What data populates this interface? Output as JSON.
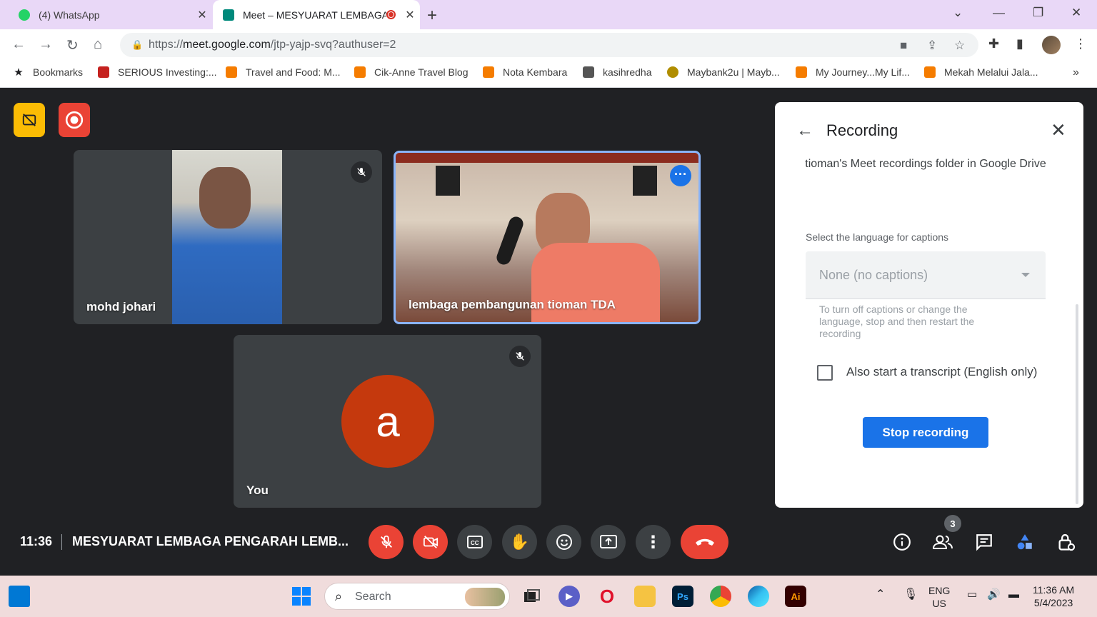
{
  "browser": {
    "tabs": [
      {
        "title": "(4) WhatsApp",
        "favicon_color": "#25d366"
      },
      {
        "title": "Meet – MESYUARAT LEMBAGA",
        "favicon_color": "#00897b"
      }
    ],
    "url_prefix": "https://",
    "url_host": "meet.google.com",
    "url_path": "/jtp-yajp-svq?authuser=2",
    "bookmarks": [
      {
        "label": "Bookmarks",
        "color": "#202124"
      },
      {
        "label": "SERIOUS Investing:...",
        "color": "#c5221f"
      },
      {
        "label": "Travel and Food: M...",
        "color": "#f57c00"
      },
      {
        "label": "Cik-Anne Travel Blog",
        "color": "#f57c00"
      },
      {
        "label": "Nota Kembara",
        "color": "#f57c00"
      },
      {
        "label": "kasihredha",
        "color": "#555555"
      },
      {
        "label": "Maybank2u | Mayb...",
        "color": "#b08d00"
      },
      {
        "label": "My Journey...My Lif...",
        "color": "#f57c00"
      },
      {
        "label": "Mekah Melalui Jala...",
        "color": "#f57c00"
      }
    ],
    "more_bookmarks": "»"
  },
  "meet": {
    "participants": [
      {
        "name": "mohd johari"
      },
      {
        "name": "lembaga pembangunan tioman TDA"
      },
      {
        "name": "You",
        "avatar_letter": "a",
        "avatar_color": "#c5390d"
      }
    ],
    "panel": {
      "title": "Recording",
      "description": "tioman's Meet recordings folder in Google Drive",
      "caption_label": "Select the language for captions",
      "caption_value": "None (no captions)",
      "hint": "To turn off captions or change the language, stop and then restart the recording",
      "transcript_label": "Also start a transcript (English only)",
      "stop_button": "Stop recording"
    },
    "clock": "11:36",
    "meeting_title": "MESYUARAT LEMBAGA PENGARAH LEMB...",
    "people_count": "3"
  },
  "taskbar": {
    "search_placeholder": "Search",
    "lang_line1": "ENG",
    "lang_line2": "US",
    "time": "11:36 AM",
    "date": "5/4/2023",
    "illustrator_label": "Ai",
    "photoshop_label": "Ps"
  }
}
